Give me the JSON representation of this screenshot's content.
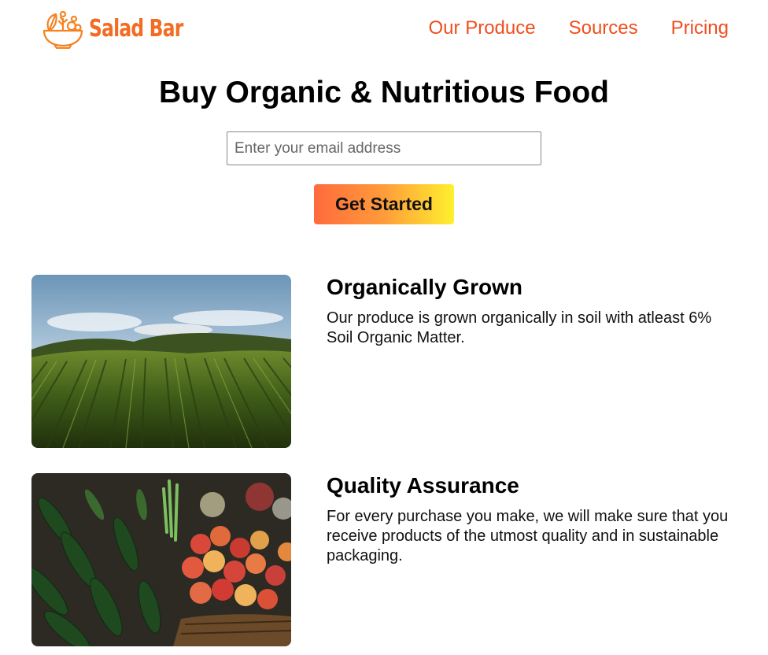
{
  "brand": {
    "name": "Salad Bar",
    "logo_icon": "salad-bowl-icon",
    "color": "#f26c23"
  },
  "nav": {
    "items": [
      {
        "label": "Our Produce"
      },
      {
        "label": "Sources"
      },
      {
        "label": "Pricing"
      }
    ],
    "color": "#f04e1e"
  },
  "hero": {
    "title": "Buy Organic & Nutritious Food",
    "email_placeholder": "Enter your email address",
    "email_value": "",
    "cta_label": "Get Started",
    "cta_gradient": [
      "#ff6a3d",
      "#fff02e"
    ]
  },
  "features": [
    {
      "title": "Organically Grown",
      "text": "Our produce is grown organically in soil with atleast 6% Soil Organic Matter.",
      "image": "farm-field-photo"
    },
    {
      "title": "Quality Assurance",
      "text": "For every purchase you make, we will make sure that you receive products of the utmost quality and in sustainable packaging.",
      "image": "vegetable-market-photo"
    }
  ]
}
